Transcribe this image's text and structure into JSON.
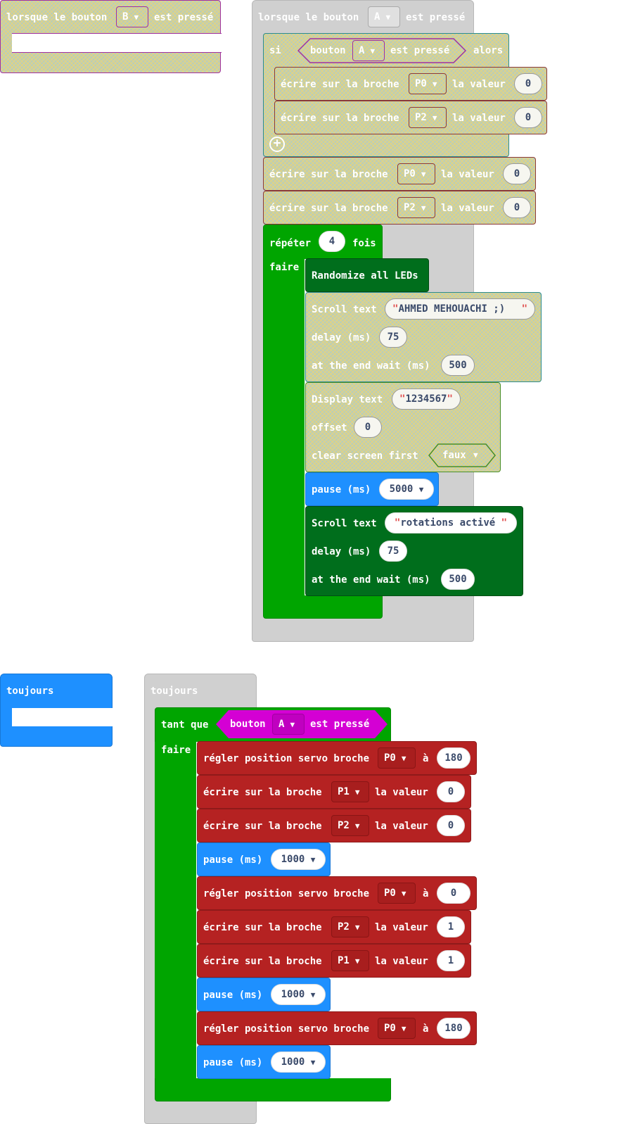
{
  "blocks": {
    "on_b": {
      "prefix": "lorsque le bouton",
      "button": "B",
      "suffix": "est pressé"
    },
    "on_a": {
      "prefix": "lorsque le bouton",
      "button": "A",
      "suffix": "est pressé"
    },
    "if_block": {
      "si": "si",
      "cond_prefix": "bouton",
      "cond_button": "A",
      "cond_suffix": "est pressé",
      "alors": "alors"
    },
    "digital_write_label": "écrire sur la broche",
    "valeur_label": "la valeur",
    "if_writes": [
      {
        "pin": "P0",
        "value": "0"
      },
      {
        "pin": "P2",
        "value": "0"
      }
    ],
    "after_writes": [
      {
        "pin": "P0",
        "value": "0"
      },
      {
        "pin": "P2",
        "value": "0"
      }
    ],
    "repeat": {
      "label": "répéter",
      "count": "4",
      "fois": "fois",
      "faire": "faire"
    },
    "randomize": "Randomize all LEDs",
    "scroll1": {
      "label": "Scroll text",
      "text": "AHMED MEHOUACHI ;)",
      "delay_label": "delay (ms)",
      "delay": "75",
      "wait_label": "at the end wait (ms)",
      "wait": "500"
    },
    "display": {
      "label": "Display text",
      "text": "1234567",
      "offset_label": "offset",
      "offset": "0",
      "clear_label": "clear screen first",
      "clear": "faux"
    },
    "pause_label": "pause (ms)",
    "pause1": "5000",
    "scroll2": {
      "label": "Scroll text",
      "text": "rotations activé",
      "delay_label": "delay (ms)",
      "delay": "75",
      "wait_label": "at the end wait (ms)",
      "wait": "500"
    },
    "forever_label": "toujours",
    "while": {
      "label": "tant que",
      "cond_prefix": "bouton",
      "cond_button": "A",
      "cond_suffix": "est pressé",
      "faire": "faire"
    },
    "servo_label": "régler position servo broche",
    "a_label": "à",
    "loop": [
      {
        "kind": "servo",
        "pin": "P0",
        "value": "180"
      },
      {
        "kind": "write",
        "pin": "P1",
        "value": "0"
      },
      {
        "kind": "write",
        "pin": "P2",
        "value": "0"
      },
      {
        "kind": "pause",
        "value": "1000"
      },
      {
        "kind": "servo",
        "pin": "P0",
        "value": "0"
      },
      {
        "kind": "write",
        "pin": "P2",
        "value": "1"
      },
      {
        "kind": "write",
        "pin": "P1",
        "value": "1"
      },
      {
        "kind": "pause",
        "value": "1000"
      },
      {
        "kind": "servo",
        "pin": "P0",
        "value": "180"
      },
      {
        "kind": "pause",
        "value": "1000"
      }
    ]
  },
  "icons": {
    "dropdown": "caret-down-icon",
    "add": "plus-circle-icon"
  },
  "colors": {
    "disabled": "#cfcfa0",
    "hat_disabled": "#d0d0d0",
    "loops": "#00a500",
    "led": "#006e1c",
    "basic": "#1e90ff",
    "pins": "#b52222",
    "input": "#d400d4"
  }
}
